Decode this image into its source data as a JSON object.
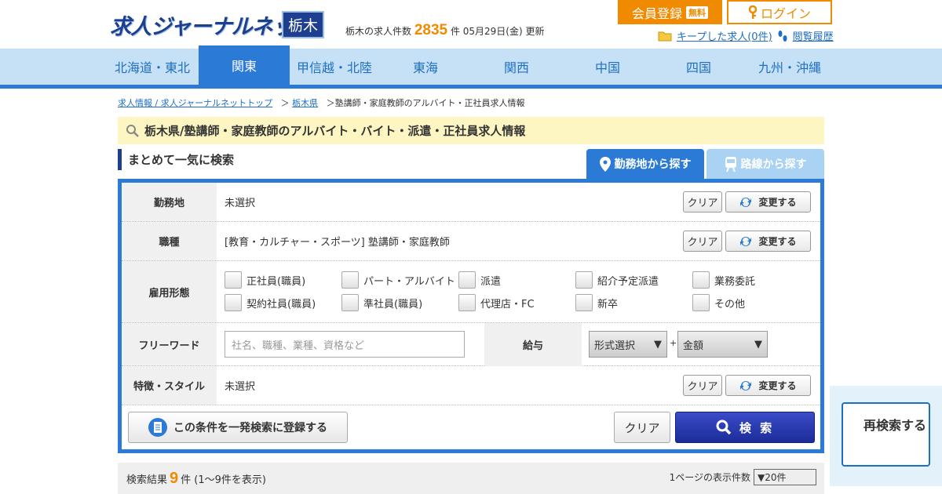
{
  "header": {
    "logo": "求人ジャーナルネット",
    "pref_badge": "栃木",
    "count_prefix": "栃木の求人件数",
    "count": "2835",
    "count_suffix": "件 05月29日(金) 更新",
    "register": "会員登録",
    "free": "無料",
    "login": "ログイン",
    "kept_jobs": "キープした求人(0件)",
    "history": "閲覧履歴"
  },
  "nav": [
    "北海道・東北",
    "関東",
    "甲信越・北陸",
    "東海",
    "関西",
    "中国",
    "四国",
    "九州・沖縄"
  ],
  "breadcrumb": {
    "top": "求人情報 / 求人ジャーナルネットトップ",
    "sep1": "＞",
    "pref": "栃木県",
    "current": "＞塾講師・家庭教師のアルバイト・正社員求人情報"
  },
  "page_title": "栃木県/塾講師・家庭教師のアルバイト・バイト・派遣・正社員求人情報",
  "search": {
    "heading": "まとめて一気に検索",
    "tab_area": "勤務地から探す",
    "tab_line": "路線から探す",
    "rows": {
      "location_label": "勤務地",
      "location_value": "未選択",
      "job_label": "職種",
      "job_value": "[教育・カルチャー・スポーツ] 塾講師・家庭教師",
      "employment_label": "雇用形態",
      "employment_options": [
        "正社員(職員)",
        "パート・アルバイト",
        "派遣",
        "紹介予定派遣",
        "業務委託",
        "契約社員(職員)",
        "準社員(職員)",
        "代理店・FC",
        "新卒",
        "その他"
      ],
      "freeword_label": "フリーワード",
      "freeword_placeholder": "社名、職種、業種、資格など",
      "salary_label": "給与",
      "salary_type": "形式選択",
      "salary_amount": "金額",
      "salary_sep": "+",
      "feature_label": "特徴・スタイル",
      "feature_value": "未選択"
    },
    "clear": "クリア",
    "change": "変更する",
    "register_condition": "この条件を一発検索に登録する",
    "search_button": "検 索"
  },
  "result": {
    "prefix": "検索結果",
    "count": "9",
    "suffix": "件 (1～9件を表示)",
    "per_page_label": "1ページの表示件数",
    "per_page_value": "▼20件"
  },
  "research": "再検索する"
}
